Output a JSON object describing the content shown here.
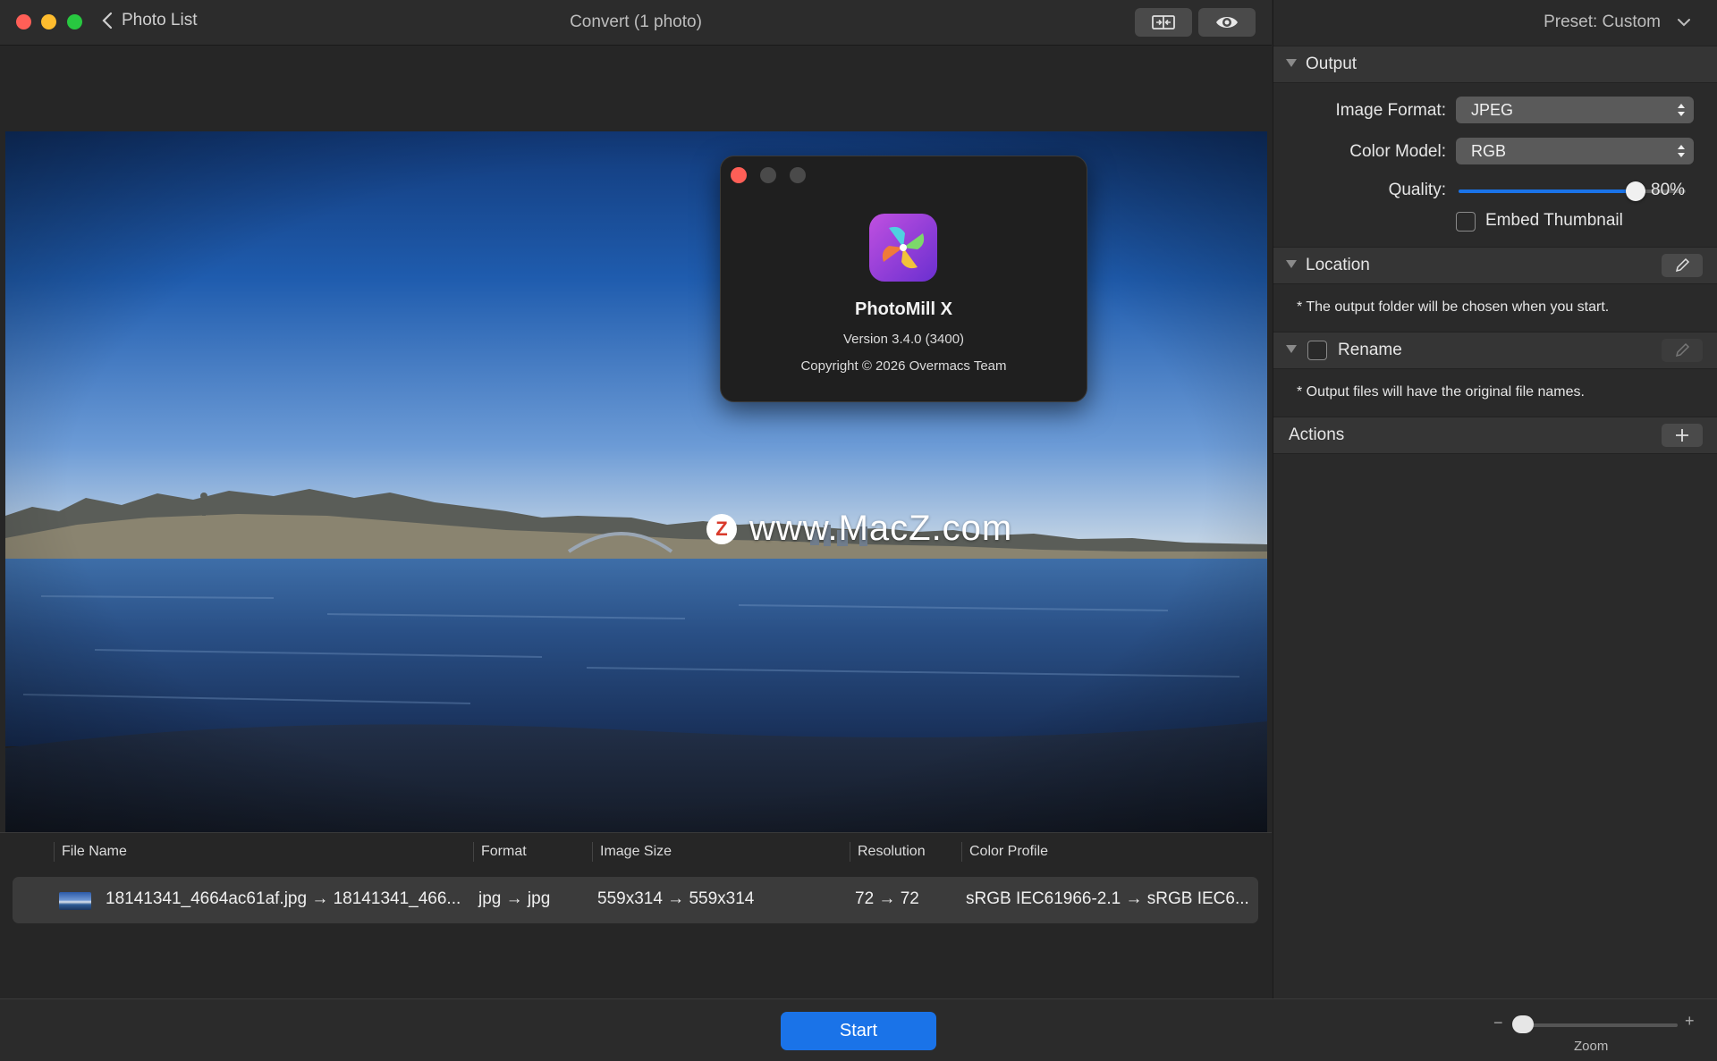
{
  "window": {
    "back_label": "Photo List",
    "title": "Convert (1 photo)"
  },
  "about": {
    "app_name": "PhotoMill X",
    "version": "Version 3.4.0 (3400)",
    "copyright": "Copyright © 2026 Overmacs Team"
  },
  "watermark": {
    "badge": "Z",
    "text": "www.MacZ.com"
  },
  "table": {
    "columns": [
      "File Name",
      "Format",
      "Image Size",
      "Resolution",
      "Color Profile"
    ],
    "rows": [
      {
        "file_name": "18141341_4664ac61af.jpg → 18141341_466...",
        "format": "jpg → jpg",
        "image_size": "559x314 → 559x314",
        "resolution": "72 → 72",
        "color_profile": "sRGB IEC61966-2.1 → sRGB IEC6..."
      }
    ]
  },
  "bottom": {
    "start_label": "Start",
    "zoom_label": "Zoom",
    "zoom_minus": "−",
    "zoom_plus": "+",
    "zoom_level": 0.02
  },
  "sidebar": {
    "preset_label": "Preset: Custom",
    "output": {
      "title": "Output",
      "image_format_label": "Image Format:",
      "image_format_value": "JPEG",
      "color_model_label": "Color Model:",
      "color_model_value": "RGB",
      "quality_label": "Quality:",
      "quality_value": "80%",
      "quality_fraction": 0.8,
      "embed_thumbnail_label": "Embed Thumbnail",
      "embed_thumbnail_checked": false
    },
    "location": {
      "title": "Location",
      "note": "* The output folder will be chosen when you start."
    },
    "rename": {
      "title": "Rename",
      "checked": false,
      "note": "* Output files will have the original file names."
    },
    "actions": {
      "title": "Actions"
    }
  },
  "colors": {
    "accent": "#1a73e8",
    "close": "#ff5f57",
    "minimize": "#febc2e",
    "zoom": "#28c840"
  }
}
